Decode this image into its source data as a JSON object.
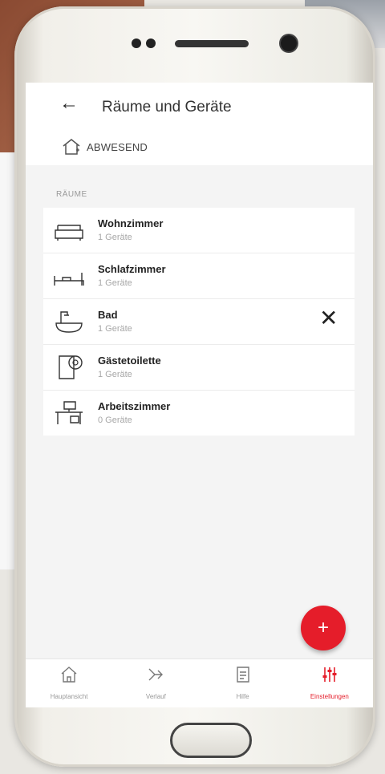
{
  "app": {
    "title": "Räume und Geräte",
    "back_icon": "back-arrow-icon"
  },
  "status": {
    "icon": "home-outline-icon",
    "label": "ABWESEND"
  },
  "section_label": "RÄUME",
  "rooms": [
    {
      "name": "Wohnzimmer",
      "count": "1 Geräte",
      "icon": "sofa-icon"
    },
    {
      "name": "Schlafzimmer",
      "count": "1 Geräte",
      "icon": "bed-icon"
    },
    {
      "name": "Bad",
      "count": "1 Geräte",
      "icon": "bathtub-icon"
    },
    {
      "name": "Gästetoilette",
      "count": "1 Geräte",
      "icon": "toilet-paper-icon"
    },
    {
      "name": "Arbeitszimmer",
      "count": "0 Geräte",
      "icon": "desk-icon"
    }
  ],
  "close_icon": "close-icon",
  "fab": {
    "label": "+",
    "icon": "add-icon",
    "color": "#e51d2a"
  },
  "nav": [
    {
      "label": "Hauptansicht",
      "icon": "home-icon"
    },
    {
      "label": "Verlauf",
      "icon": "history-icon"
    },
    {
      "label": "Hilfe",
      "icon": "document-icon"
    },
    {
      "label": "Einstellungen",
      "icon": "sliders-icon",
      "active": true
    }
  ],
  "colors": {
    "accent": "#e51d2a"
  }
}
